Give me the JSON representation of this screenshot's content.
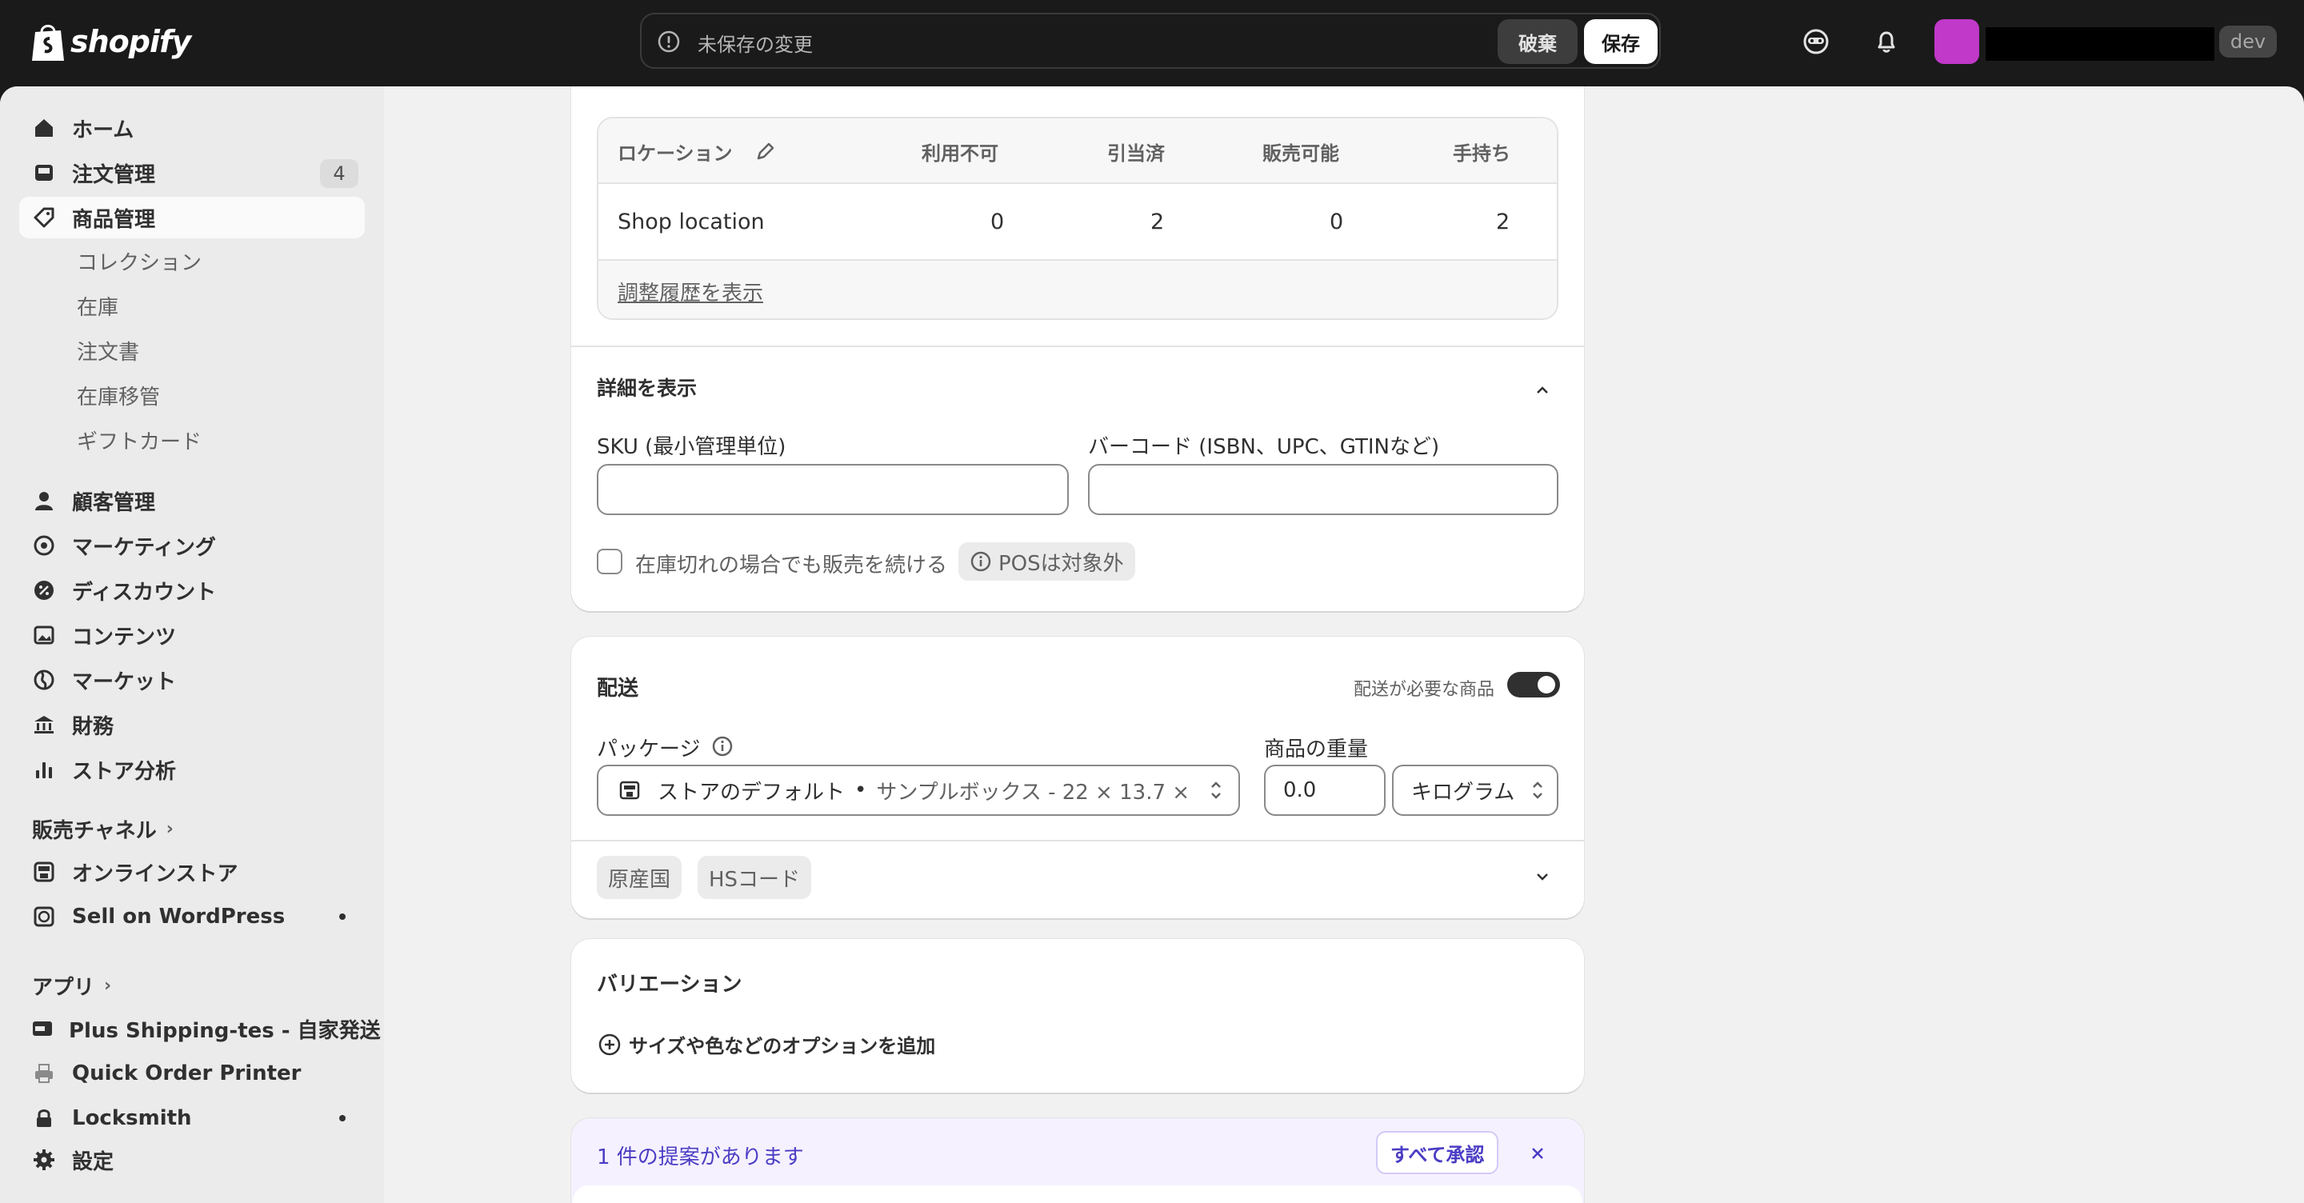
{
  "topbar": {
    "brand": "shopify",
    "unsaved_message": "未保存の変更",
    "discard_label": "破棄",
    "save_label": "保存",
    "env_tag": "dev"
  },
  "sidebar": {
    "home": "ホーム",
    "orders": "注文管理",
    "orders_badge": "4",
    "products": "商品管理",
    "product_subitems": [
      "コレクション",
      "在庫",
      "注文書",
      "在庫移管",
      "ギフトカード"
    ],
    "customers": "顧客管理",
    "marketing": "マーケティング",
    "discounts": "ディスカウント",
    "content": "コンテンツ",
    "markets": "マーケット",
    "finance": "財務",
    "analytics": "ストア分析",
    "sales_channels_header": "販売チャネル",
    "online_store": "オンラインストア",
    "sell_on_wordpress": "Sell on WordPress",
    "apps_header": "アプリ",
    "app_plus_shipping": "Plus Shipping-tes - 自家発送",
    "app_quick_order": "Quick Order Printer",
    "app_locksmith": "Locksmith",
    "settings": "設定"
  },
  "inventory": {
    "headers": [
      "ロケーション",
      "利用不可",
      "引当済",
      "販売可能",
      "手持ち"
    ],
    "rows": [
      {
        "location": "Shop location",
        "unavailable": "0",
        "committed": "2",
        "available": "0",
        "on_hand": "2"
      }
    ],
    "history_link": "調整履歴を表示"
  },
  "details": {
    "title": "詳細を表示",
    "sku_label": "SKU (最小管理単位)",
    "sku_value": "",
    "barcode_label": "バーコード (ISBN、UPC、GTINなど)",
    "barcode_value": "",
    "continue_selling_label": "在庫切れの場合でも販売を続ける",
    "pos_chip": "POSは対象外"
  },
  "shipping": {
    "title": "配送",
    "requires_shipping_label": "配送が必要な商品",
    "requires_shipping": true,
    "package_label": "パッケージ",
    "package_value_main": "ストアのデフォルト",
    "package_value_detail": "サンプルボックス - 22 × 13.7 ×",
    "weight_label": "商品の重量",
    "weight_value": "0.0",
    "weight_unit": "キログラム",
    "origin_chip": "原産国",
    "hs_chip": "HSコード"
  },
  "variations": {
    "title": "バリエーション",
    "add_option": "サイズや色などのオプションを追加"
  },
  "suggestion": {
    "text": "1 件の提案があります",
    "accept_all": "すべて承認"
  }
}
